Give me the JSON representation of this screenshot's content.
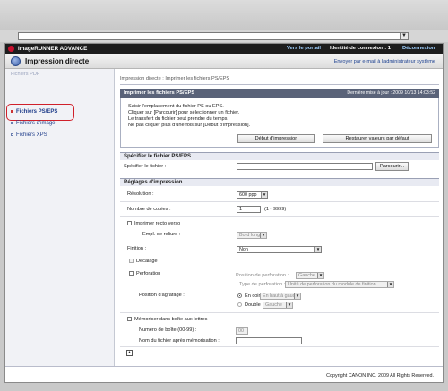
{
  "browser": {
    "address_dropdown_glyph": "▼"
  },
  "brand": {
    "name": "imageRUNNER ADVANCE",
    "portal_link": "Vers le portail",
    "login_info": "Identité de connexion : 1",
    "logout_link": "Déconnexion"
  },
  "header": {
    "title": "Impression directe",
    "email_admin_link": "Envoyer par e-mail à l'administrateur système"
  },
  "sidebar": {
    "faded_item": "Fichiers PDF",
    "items": [
      {
        "label": "Fichiers PS/EPS",
        "active": true
      },
      {
        "label": "Fichiers d'image",
        "active": false
      },
      {
        "label": "Fichiers XPS",
        "active": false
      }
    ]
  },
  "breadcrumb": "Impression directe : Imprimer les fichiers PS/EPS",
  "panel": {
    "title": "Imprimer les fichiers PS/EPS",
    "last_update": "Dernière mise à jour : 2009 10/13 14:03:52",
    "instructions": [
      "Saisir l'emplacement du fichier PS ou EPS.",
      "Cliquer sur [Parcourir] pour sélectionner un fichier.",
      "Le transfert du fichier peut prendre du temps.",
      "Ne pas cliquer plus d'une fois sur [Début d'impression]."
    ],
    "start_button": "Début d'impression",
    "restore_button": "Restaurer valeurs par défaut"
  },
  "file_section": {
    "title": "Spécifier le fichier PS/EPS",
    "file_label": "Spécifier le fichier :",
    "file_value": "",
    "browse_button": "Parcourir..."
  },
  "settings": {
    "title": "Réglages d'impression",
    "resolution_label": "Résolution :",
    "resolution_value": "600 ppp",
    "copies_label": "Nombre de copies :",
    "copies_value": "1",
    "copies_range": "(1 - 9999)",
    "duplex_label": "Imprimer recto verso",
    "binding_label": "Empl. de reliure :",
    "binding_value": "Bord long",
    "finishing_label": "Finition :",
    "finishing_value": "Non",
    "offset_label": "Décalage",
    "punch_label": "Perforation",
    "punch_position_label": "Position de perforation :",
    "punch_position_value": "Gauche",
    "punch_type_label": "Type de perforation :",
    "punch_type_value": "Unité de perforation du module de finition",
    "staple_position_label": "Position d'agrafage :",
    "corner_label": "En coin",
    "corner_value": "En haut à gauche",
    "double_label": "Double",
    "double_value": "Gauche",
    "store_label": "Mémoriser dans boîte aux lettres",
    "box_number_label": "Numéro de boîte (00-99) :",
    "box_number_value": "00",
    "stored_name_label": "Nom du fichier après mémorisation :",
    "stored_name_value": ""
  },
  "scroll_top_glyph": "▲",
  "footer": {
    "copyright": "Copyright CANON INC. 2009 All Rights Reserved."
  },
  "colors": {
    "panel_header": "#5a6379",
    "active_highlight": "#d0202a",
    "link": "#1f3d8a"
  }
}
